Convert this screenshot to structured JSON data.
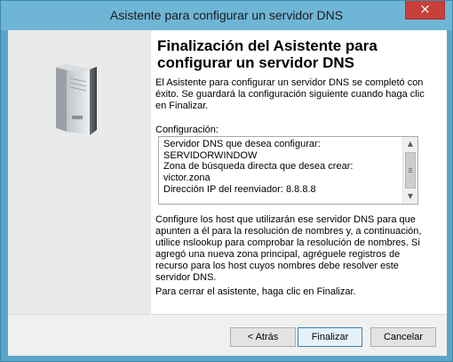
{
  "window": {
    "title": "Asistente para configurar un servidor DNS",
    "close_glyph": "×"
  },
  "wizard": {
    "heading": "Finalización del Asistente para configurar un servidor DNS",
    "intro": "El Asistente para configurar un servidor DNS se completó con éxito. Se guardará la configuración siguiente cuando haga clic en Finalizar.",
    "config_label": "Configuración:",
    "config_lines": [
      "Servidor DNS que desea configurar:",
      "SERVIDORWINDOW",
      "Zona de búsqueda directa que desea crear:",
      "victor.zona",
      "Dirección IP del reenviador: 8.8.8.8"
    ],
    "note_lines": [
      "Configure los host que utilizarán ese servidor DNS para que apunten a él para la resolución de nombres y, a continuación, utilice nslookup para comprobar la resolución de nombres. Si agregó una nueva zona principal, agréguele registros de recurso para los host cuyos nombres debe resolver este servidor DNS."
    ],
    "finish_note": "Para cerrar el asistente, haga clic en Finalizar."
  },
  "buttons": {
    "back": "< Atrás",
    "finish": "Finalizar",
    "cancel": "Cancelar"
  },
  "icons": {
    "left_panel": "server-icon",
    "scroll_up": "scroll-up-arrow-icon",
    "scroll_down": "scroll-down-arrow-icon"
  },
  "colors": {
    "title_bar": "#6fb6d6",
    "window_frame": "#5ba6c8",
    "close_button": "#c7403a",
    "left_panel": "#eaeaea",
    "footer": "#f0f0f0"
  }
}
